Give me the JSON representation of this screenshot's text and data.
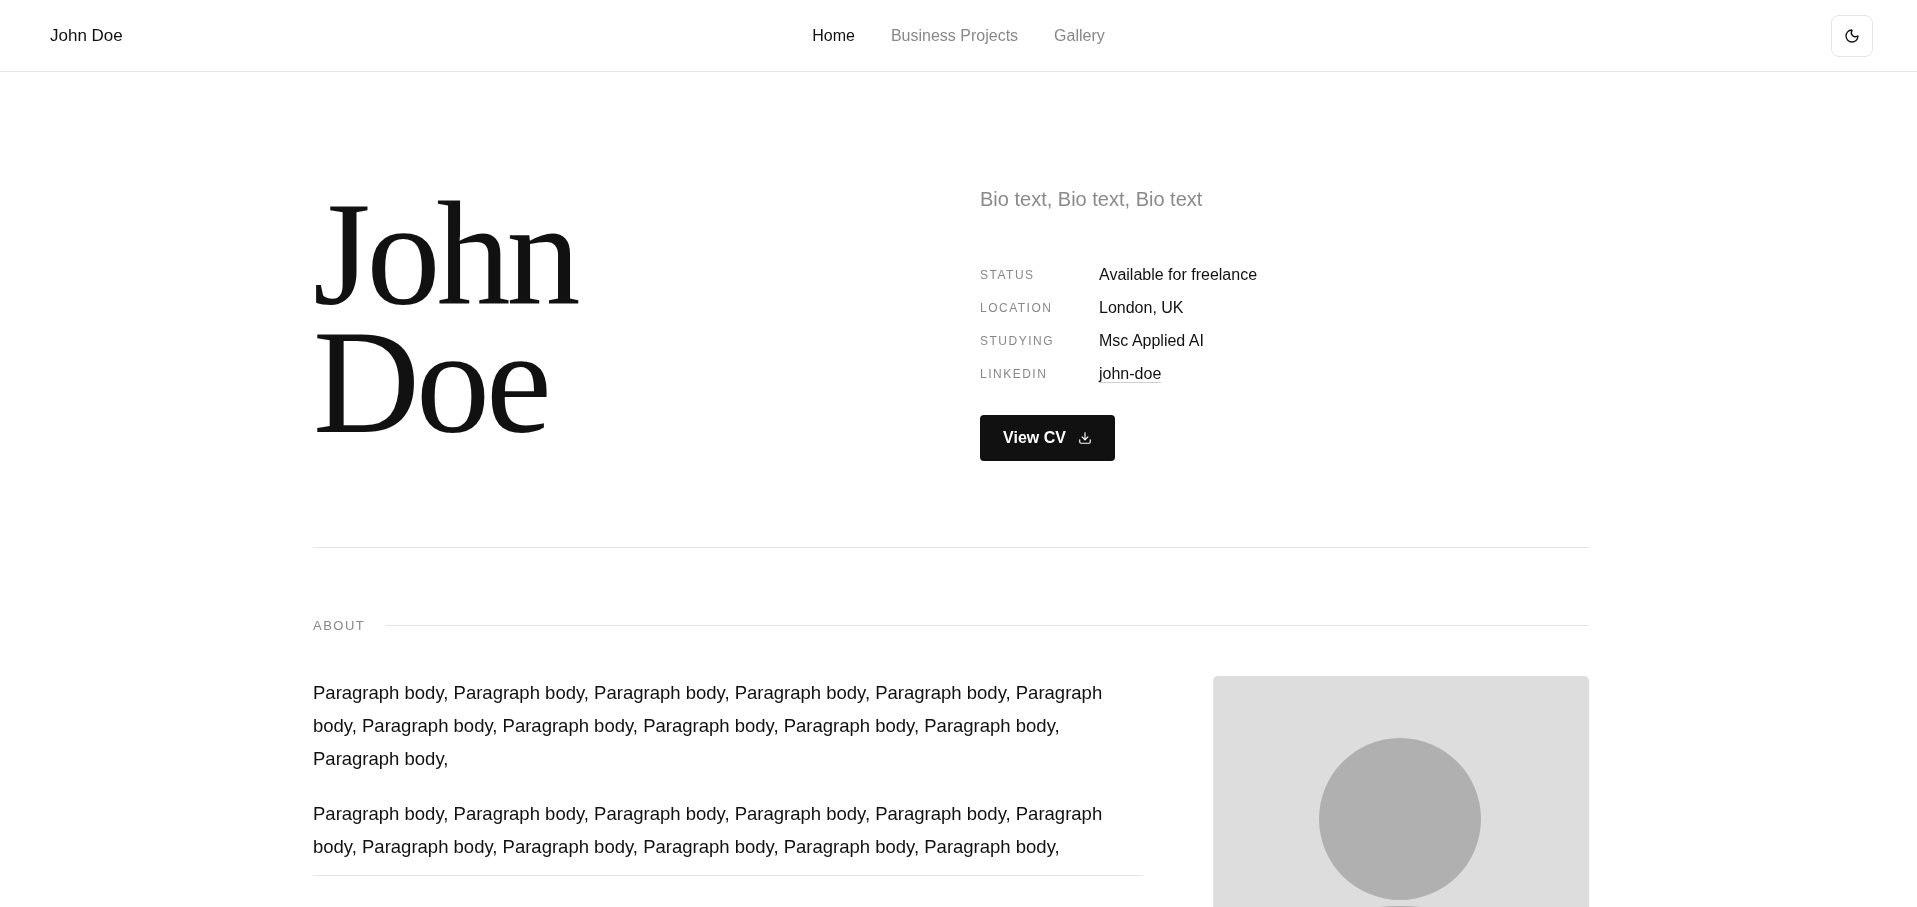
{
  "header": {
    "logo": "John Doe",
    "nav": [
      {
        "label": "Home",
        "selected": true
      },
      {
        "label": "Business Projects",
        "selected": false
      },
      {
        "label": "Gallery",
        "selected": false
      }
    ]
  },
  "hero": {
    "name_lines": [
      "John",
      "Doe"
    ],
    "bio": "Bio text, Bio text, Bio text",
    "details": [
      {
        "label": "STATUS",
        "value": "Available for freelance",
        "kind": "text"
      },
      {
        "label": "LOCATION",
        "value": "London, UK",
        "kind": "text"
      },
      {
        "label": "STUDYING",
        "value": "Msc Applied AI",
        "kind": "text"
      },
      {
        "label": "LINKEDIN",
        "value": "john-doe",
        "kind": "link"
      }
    ],
    "cv_button": "View CV"
  },
  "about": {
    "heading": "ABOUT",
    "paragraphs": [
      "Paragraph body, Paragraph body, Paragraph body, Paragraph body, Paragraph body, Paragraph body, Paragraph body, Paragraph body, Paragraph body, Paragraph body, Paragraph body, Paragraph body,",
      "Paragraph body, Paragraph body, Paragraph body, Paragraph body, Paragraph body, Paragraph body, Paragraph body, Paragraph body, Paragraph body, Paragraph body, Paragraph body,"
    ]
  }
}
